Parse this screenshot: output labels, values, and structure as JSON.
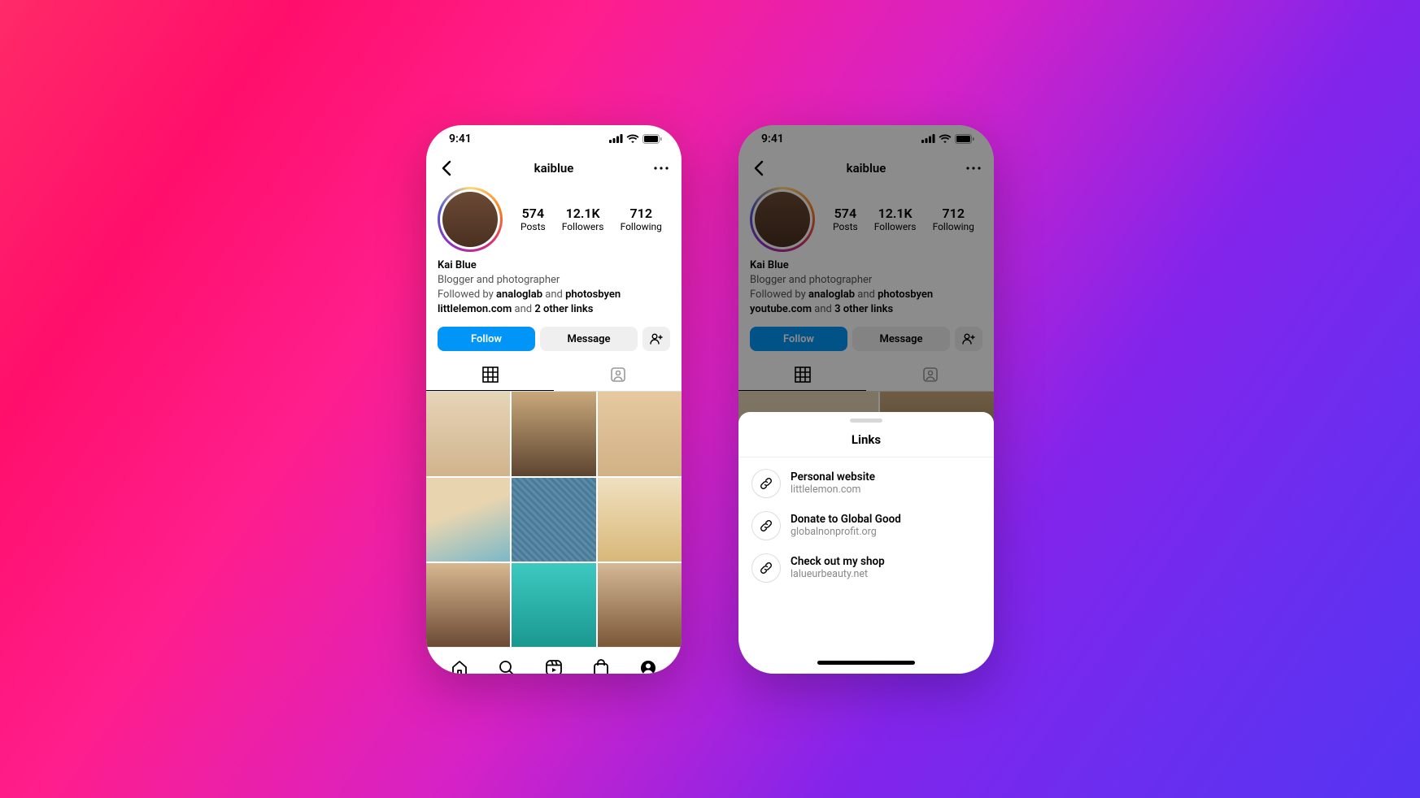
{
  "status": {
    "time": "9:41"
  },
  "nav": {
    "username": "kaiblue"
  },
  "stats": {
    "posts_num": "574",
    "posts_lbl": "Posts",
    "followers_num": "12.1K",
    "followers_lbl": "Followers",
    "following_num": "712",
    "following_lbl": "Following"
  },
  "bio": {
    "name": "Kai Blue",
    "sub": "Blogger and photographer",
    "followed_prefix": "Followed by ",
    "followed_user1": "analoglab",
    "followed_and": " and ",
    "followed_user2": "photosbyen"
  },
  "links_line_a": {
    "url": "littlelemon.com",
    "and": " and ",
    "more": "2 other links"
  },
  "links_line_b": {
    "url": "youtube.com",
    "and": " and ",
    "more": "3 other links"
  },
  "actions": {
    "follow": "Follow",
    "message": "Message"
  },
  "sheet": {
    "title": "Links",
    "items": [
      {
        "title": "Personal website",
        "url": "littlelemon.com"
      },
      {
        "title": "Donate to Global Good",
        "url": "globalnonprofit.org"
      },
      {
        "title": "Check out my shop",
        "url": "lalueurbeauty.net"
      }
    ]
  }
}
